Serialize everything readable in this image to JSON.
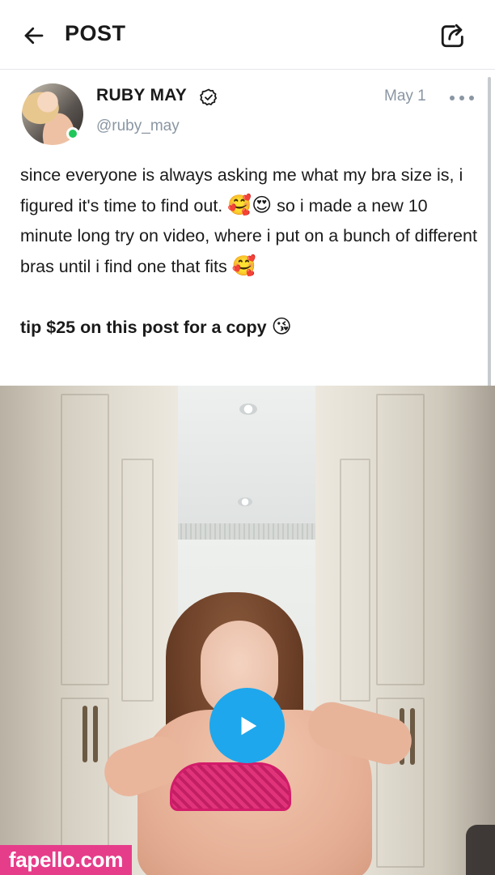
{
  "header": {
    "title": "POST",
    "back_icon": "arrow-left-icon",
    "share_icon": "share-icon"
  },
  "post": {
    "author": {
      "display_name": "RUBY MAY",
      "username": "@ruby_may",
      "verified_icon": "verified-badge-icon",
      "online": true
    },
    "date": "May 1",
    "more_icon": "more-horizontal-icon",
    "text": {
      "line1_before": "since everyone is always asking me what my bra size is, i figured it's time to find out.",
      "line1_emoji": "🥰😍",
      "line1_after": "so i made a new 10 minute long try on video, where i put on a bunch of different bras until i find one that fits",
      "line1_end_emoji": "🥰",
      "tip_line": "tip $25 on this post for a copy",
      "tip_emoji": "😘"
    },
    "media": {
      "type": "video",
      "play_icon": "play-icon"
    }
  },
  "watermark": {
    "text": "fapello.com"
  },
  "colors": {
    "accent": "#1ea7ec",
    "online": "#20c65a",
    "muted_text": "#8a96a3",
    "watermark_bg": "#e63d8a"
  }
}
